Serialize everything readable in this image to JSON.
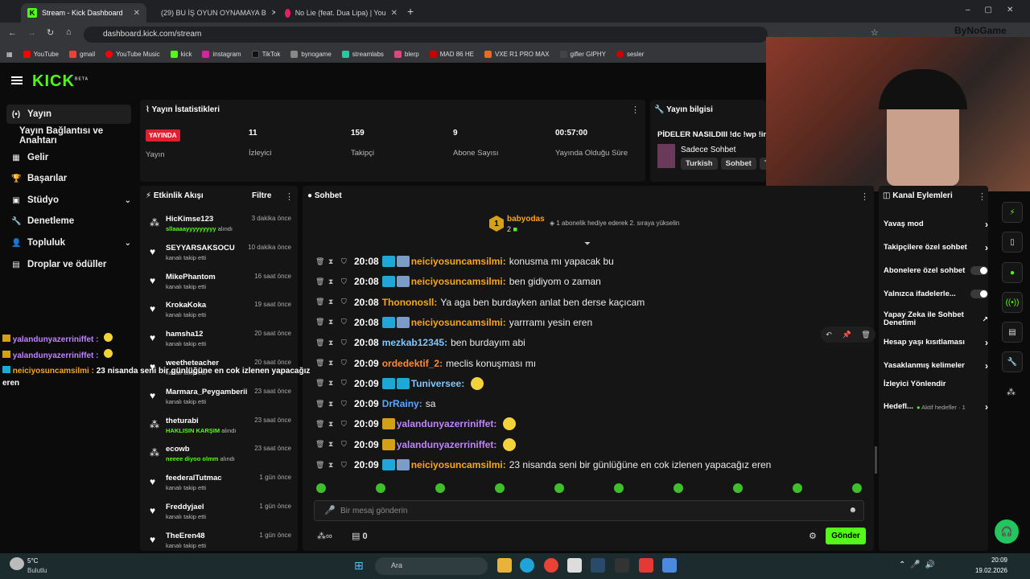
{
  "browser": {
    "tabs": [
      {
        "title": "Stream - Kick Dashboard"
      },
      {
        "title": "(29) BU İŞ OYUN OYNAMAYA B"
      },
      {
        "title": "No Lie (feat. Dua Lipa) | You"
      }
    ],
    "url": "dashboard.kick.com/stream",
    "profile": "ByNoGame",
    "bookmarks": [
      "YouTube",
      "gmail",
      "YouTube Music",
      "kick",
      "instagram",
      "TikTok",
      "bynogame",
      "streamlabs",
      "blerp",
      "MAD 86 HE",
      "VXE R1 PRO MAX",
      "gifler GIPHY",
      "sesler"
    ]
  },
  "app": {
    "logo": "KICK",
    "logo_beta": "BETA",
    "nav": [
      {
        "label": "Yayın",
        "icon": "(•)"
      },
      {
        "label": "Yayın Bağlantısı ve Anahtarı",
        "icon": ""
      },
      {
        "label": "Gelir",
        "icon": "▦"
      },
      {
        "label": "Başarılar",
        "icon": "🏆"
      },
      {
        "label": "Stüdyo",
        "icon": "▣"
      },
      {
        "label": "Denetleme",
        "icon": "🔧"
      },
      {
        "label": "Topluluk",
        "icon": "👤"
      },
      {
        "label": "Droplar ve ödüller",
        "icon": "▤"
      }
    ]
  },
  "stats": {
    "title": "Yayın İstatistikleri",
    "live_label": "YAYINDA",
    "live_sub": "Yayın",
    "items": [
      {
        "value": "11",
        "label": "İzleyici"
      },
      {
        "value": "159",
        "label": "Takipçi"
      },
      {
        "value": "9",
        "label": "Abone Sayısı"
      },
      {
        "value": "00:57:00",
        "label": "Yayında Olduğu Süre"
      }
    ]
  },
  "info": {
    "title": "Yayın bilgisi",
    "stream_title": "PİDELER NASILDIII !dc !wp !ins",
    "category": "Sadece Sohbet",
    "tags": [
      "Turkish",
      "Sohbet",
      "T"
    ]
  },
  "activity": {
    "title": "Etkinlik Akışı",
    "filter": "Filtre",
    "items": [
      {
        "name": "HicKimse123",
        "time": "3 dakika önce",
        "sub_green": "sllaaaayyyyyyyyy",
        "sub": "alındı",
        "icon": "gift"
      },
      {
        "name": "SEYYARSAKSOCU",
        "time": "10 dakika önce",
        "sub_green": "",
        "sub": "kanalı takip etti",
        "icon": "heart"
      },
      {
        "name": "MikePhantom",
        "time": "16 saat önce",
        "sub_green": "",
        "sub": "kanalı takip etti",
        "icon": "heart"
      },
      {
        "name": "KrokaKoka",
        "time": "19 saat önce",
        "sub_green": "",
        "sub": "kanalı takip etti",
        "icon": "heart"
      },
      {
        "name": "hamsha12",
        "time": "20 saat önce",
        "sub_green": "",
        "sub": "kanalı takip etti",
        "icon": "heart"
      },
      {
        "name": "weetheteacher",
        "time": "20 saat önce",
        "sub_green": "",
        "sub": "kanalı takip etti",
        "icon": "heart"
      },
      {
        "name": "Marmara_Peygamberii",
        "time": "23 saat önce",
        "sub_green": "",
        "sub": "kanalı takip etti",
        "icon": "heart"
      },
      {
        "name": "theturabi",
        "time": "23 saat önce",
        "sub_green": "HAKLISIN KARŞIM",
        "sub": "alındı",
        "icon": "gift"
      },
      {
        "name": "ecowb",
        "time": "23 saat önce",
        "sub_green": "neeee diyoo olmm",
        "sub": "alındı",
        "icon": "gift"
      },
      {
        "name": "feederalTutmac",
        "time": "1 gün önce",
        "sub_green": "",
        "sub": "kanalı takip etti",
        "icon": "heart"
      },
      {
        "name": "Freddyjael",
        "time": "1 gün önce",
        "sub_green": "",
        "sub": "kanalı takip etti",
        "icon": "heart"
      },
      {
        "name": "TheEren48",
        "time": "1 gün önce",
        "sub_green": "",
        "sub": "kanalı takip etti",
        "icon": "heart"
      }
    ]
  },
  "chat": {
    "title": "Sohbet",
    "pinned_user": "babyodas",
    "pinned_count": "2",
    "pinned_rank": "1",
    "pinned_text": "1 abonelik hediye ederek 2. sıraya yükselin",
    "messages": [
      {
        "time": "20:08",
        "user": "neiciyosuncamsilmi",
        "color": "#f5a623",
        "text": "konusma mı yapacak bu",
        "badges": [
          "b3",
          "b2"
        ],
        "emote": false
      },
      {
        "time": "20:08",
        "user": "neiciyosuncamsilmi",
        "color": "#f5a623",
        "text": "ben gidiyom o zaman",
        "badges": [
          "b3",
          "b2"
        ],
        "emote": false
      },
      {
        "time": "20:08",
        "user": "Thononosll",
        "color": "#f5a623",
        "text": "Ya aga ben burdayken anlat ben derse kaçıcam",
        "badges": [],
        "emote": false
      },
      {
        "time": "20:08",
        "user": "neiciyosuncamsilmi",
        "color": "#f5a623",
        "text": "yarrramı yesin eren",
        "badges": [
          "b3",
          "b2"
        ],
        "emote": false
      },
      {
        "time": "20:08",
        "user": "mezkab12345",
        "color": "#7ec8ff",
        "text": "ben burdayım abi",
        "badges": [],
        "emote": false
      },
      {
        "time": "20:09",
        "user": "ordedektif_2",
        "color": "#ff8a3d",
        "text": "meclis konuşması mı",
        "badges": [],
        "emote": false
      },
      {
        "time": "20:09",
        "user": "Tuniversee",
        "color": "#7ec8ff",
        "text": "",
        "badges": [
          "b3",
          "b3"
        ],
        "emote": true
      },
      {
        "time": "20:09",
        "user": "DrRainy",
        "color": "#5aa9ff",
        "text": "sa",
        "badges": [],
        "emote": false
      },
      {
        "time": "20:09",
        "user": "yalandunyazerriniffet",
        "color": "#c084fc",
        "text": "",
        "badges": [
          "b4"
        ],
        "emote": true
      },
      {
        "time": "20:09",
        "user": "yalandunyazerriniffet",
        "color": "#c084fc",
        "text": "",
        "badges": [
          "b4"
        ],
        "emote": true
      },
      {
        "time": "20:09",
        "user": "neiciyosuncamsilmi",
        "color": "#f5a623",
        "text": "23 nisanda seni bir günlüğüne en cok izlenen yapacağız eren",
        "badges": [
          "b3",
          "b2"
        ],
        "emote": false
      }
    ],
    "input_placeholder": "Bir mesaj gönderin",
    "send_label": "Gönder",
    "points": "0"
  },
  "actions": {
    "title": "Kanal Eylemleri",
    "rows": [
      {
        "label": "Yavaş mod",
        "type": "arrow"
      },
      {
        "label": "Takipçilere özel sohbet",
        "type": "arrow"
      },
      {
        "label": "Abonelere özel sohbet",
        "type": "toggle"
      },
      {
        "label": "Yalnızca ifadelerle...",
        "type": "toggle"
      },
      {
        "label": "Yapay Zeka ile Sohbet Denetimi",
        "type": "ext"
      },
      {
        "label": "Hesap yaşı kısıtlaması",
        "type": "arrow"
      },
      {
        "label": "Yasaklanmış kelimeler",
        "type": "arrow"
      },
      {
        "label": "İzleyici Yönlendir",
        "type": "none"
      },
      {
        "label": "Hedefl...",
        "type": "arrow"
      }
    ],
    "goal_status": "Aktif hedefler · 1"
  },
  "overlay": [
    {
      "user": "yalandunyazerriniffet :",
      "text": "",
      "color": "#c084fc"
    },
    {
      "user": "yalandunyazerriniffet :",
      "text": "",
      "color": "#c084fc"
    },
    {
      "user": "neiciyosuncamsilmi :",
      "text": "23 nisanda seni bir günlüğüne en cok izlenen yapacağız eren",
      "color": "#f5a623"
    }
  ],
  "taskbar": {
    "weather_temp": "5°C",
    "weather_desc": "Bulutlu",
    "search": "Ara",
    "time": "20:09",
    "date": "19.02.2026"
  }
}
